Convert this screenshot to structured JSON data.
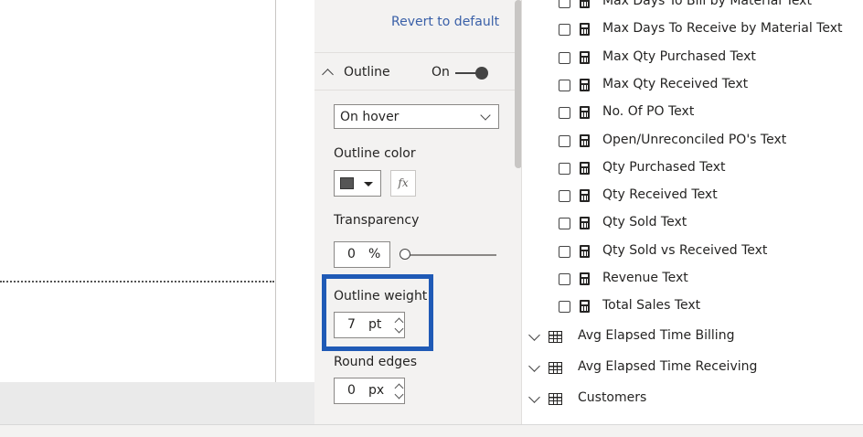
{
  "format_pane": {
    "revert_label": "Revert to default",
    "outline": {
      "header_label": "Outline",
      "toggle_state_label": "On",
      "mode_dropdown_value": "On hover",
      "color_label": "Outline color",
      "color_value": "#555555",
      "fx_label": "fx",
      "transparency_label": "Transparency",
      "transparency_value": "0",
      "transparency_unit": "%",
      "transparency_slider_percent": 0,
      "weight_label": "Outline weight",
      "weight_value": "7",
      "weight_unit": "pt",
      "round_edges_label": "Round edges",
      "round_edges_value": "0",
      "round_edges_unit": "px"
    }
  },
  "fields_pane": {
    "measures": [
      "Max Days To Bill by Material Text",
      "Max Days To Receive by Material Text",
      "Max Qty Purchased Text",
      "Max Qty Received Text",
      "No. Of PO Text",
      "Open/Unreconciled PO's Text",
      "Qty Purchased Text",
      "Qty Received Text",
      "Qty Sold Text",
      "Qty Sold vs Received Text",
      "Revenue Text",
      "Total Sales Text"
    ],
    "tables": [
      "Avg Elapsed Time Billing",
      "Avg Elapsed Time Receiving",
      "Customers"
    ]
  },
  "colors": {
    "highlight_border": "#1f5ab6",
    "link": "#3a60a8",
    "pane_background": "#f3f2f1"
  }
}
